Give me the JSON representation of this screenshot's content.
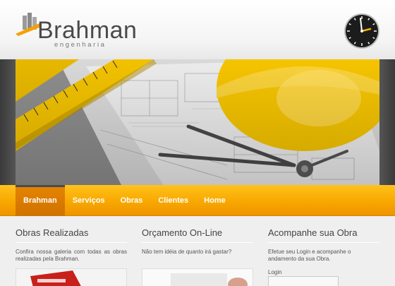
{
  "brand": {
    "name": "Brahman",
    "tagline": "engenharia",
    "colors": {
      "accent": "#f8a800",
      "text": "#4a4a4a",
      "logo_mark": "#f5a000"
    }
  },
  "header": {
    "clock_icon": "clock-icon"
  },
  "banner": {
    "image": "construction-blueprint-helmet-compass"
  },
  "nav": {
    "items": [
      {
        "label": "Brahman",
        "active": true
      },
      {
        "label": "Serviços",
        "active": false
      },
      {
        "label": "Obras",
        "active": false
      },
      {
        "label": "Clientes",
        "active": false
      },
      {
        "label": "Home",
        "active": false
      }
    ]
  },
  "columns": {
    "obras": {
      "title": "Obras Realizadas",
      "text": "Confira nossa galeria com todas as obras realizadas pela Brahman."
    },
    "orcamento": {
      "title": "Orçamento On-Line",
      "text": "Não tem idéia de quanto irá gastar?"
    },
    "acompanhe": {
      "title": "Acompanhe sua Obra",
      "text": "Efetue seu Login e acompanhe o andamento da sua Obra.",
      "login_label": "Login",
      "login_value": ""
    }
  }
}
